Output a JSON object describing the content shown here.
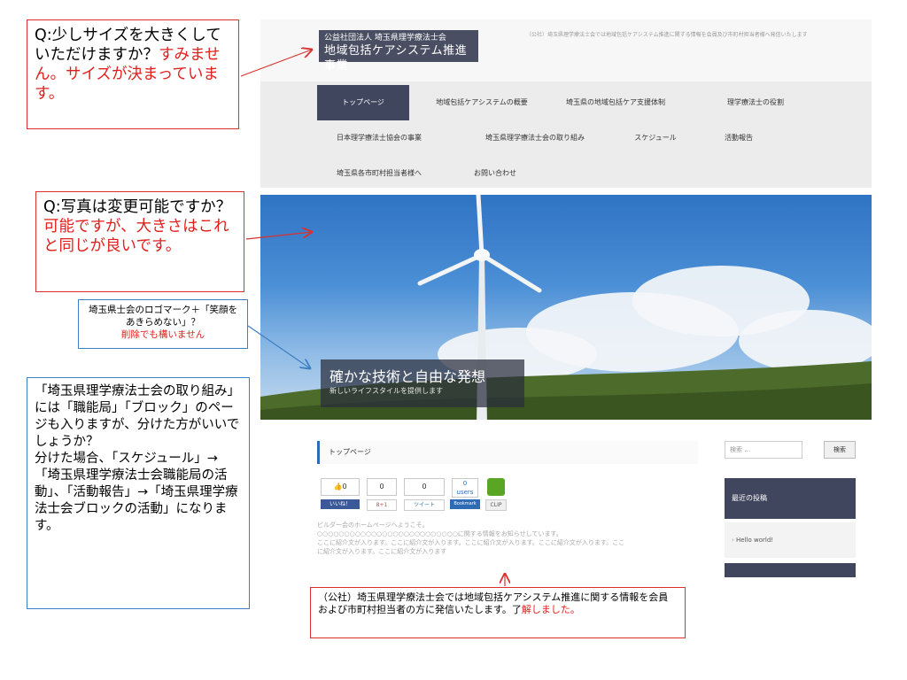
{
  "site": {
    "logo_sub": "公益社団法人 埼玉県理学療法士会",
    "logo_main": "地域包括ケアシステム推進事業",
    "header_desc": "（公社）埼玉県理学療法士会では地域包括ケアシステム推進に関する情報を会員及び市町村担当者様へ発信いたします",
    "nav": [
      {
        "label": "トップページ",
        "active": true
      },
      {
        "label": "地域包括ケアシステムの概要",
        "active": false
      },
      {
        "label": "埼玉県の地域包括ケア支援体制",
        "active": false
      },
      {
        "label": "理学療法士の役割",
        "active": false
      },
      {
        "label": "日本理学療法士協会の事業",
        "active": false
      },
      {
        "label": "埼玉県理学療法士会の取り組み",
        "active": false
      },
      {
        "label": "スケジュール",
        "active": false
      },
      {
        "label": "活動報告",
        "active": false
      },
      {
        "label": "埼玉県各市町村担当者様へ",
        "active": false
      },
      {
        "label": "お問い合わせ",
        "active": false
      }
    ],
    "hero": {
      "caption_main": "確かな技術と自由な発想",
      "caption_sub": "新しいライフスタイルを提供します"
    },
    "content": {
      "page_title": "トップページ",
      "social": {
        "like_count": "0",
        "gplus_count": "0",
        "tweet_count": "0",
        "hatena_count": "0",
        "hatena_unit": "users",
        "like_label": "いいね！",
        "gplus_label": "8+1",
        "tweet_label": "ツイート",
        "bookmark_label": "Bookmark",
        "clip_label": "CLIP"
      },
      "body_line1": "ビルダー会のホームページへようこそ。",
      "body_line2": "○○○○○○○○○○○○○○○○○○○○○○○○○○に関する情報をお知らせしています。",
      "body_line3": "ここに紹介文が入ります。ここに紹介文が入ります。ここに紹介文が入ります。ここに紹介文が入ります。ここ",
      "body_line4": "に紹介文が入ります。ここに紹介文が入ります"
    },
    "sidebar": {
      "search_placeholder": "検索 …",
      "search_button": "検索",
      "recent_posts_title": "最近の投稿",
      "recent_post_item": "Hello world!"
    }
  },
  "annotations": {
    "size_q": "Q:少しサイズを大きくしていただけますか？",
    "size_a": "すみません。サイズが決まっています。",
    "photo_q": "Q:写真は変更可能ですか？",
    "photo_a": "可能ですが、大きさはこれと同じが良いです。",
    "logo_note": "埼玉県士会のロゴマーク＋「笑顔をあきらめない」？",
    "logo_note_red": "削除でも構いません",
    "torikumi_note": "「埼玉県理学療法士会の取り組み」には「職能局」「ブロック」のページも入りますが、分けた方がいいでしょうか？",
    "torikumi_note2": "分けた場合、「スケジュール」→「埼玉県理学療法士会職能局の活動」、「活動報告」→「埼玉県理学療法士会ブロックの活動」になります。",
    "desc_note": "（公社）埼玉県理学療法士会では地域包括ケアシステム推進に関する情報を会員および市町村担当者の方に発信いたします。了",
    "desc_note_red": "解しました。"
  },
  "colors": {
    "nav_active": "#40465e",
    "accent_red": "#e0201d",
    "callout_blue": "#3b7fc4"
  }
}
